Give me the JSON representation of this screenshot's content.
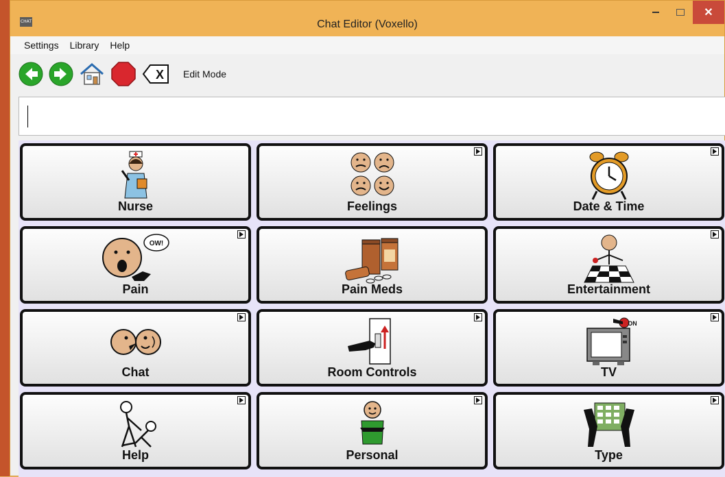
{
  "window": {
    "title": "Chat Editor (Voxello)",
    "app_icon_text": "CHAT",
    "close_glyph": "✕"
  },
  "menu": [
    "Settings",
    "Library",
    "Help"
  ],
  "toolbar": {
    "buttons": [
      {
        "icon": "back-arrow-icon",
        "color": "#2aa52a"
      },
      {
        "icon": "forward-arrow-icon",
        "color": "#2aa52a"
      },
      {
        "icon": "home-icon",
        "color": "#4a8bd0"
      },
      {
        "icon": "stop-icon",
        "color": "#d9272e"
      },
      {
        "icon": "clear-icon",
        "color": "#111111"
      }
    ],
    "clear_glyph": "X",
    "mode_label": "Edit Mode"
  },
  "message_bar": {
    "value": ""
  },
  "tiles": [
    {
      "label": "Nurse",
      "icon": "nurse-icon",
      "has_submenu": false
    },
    {
      "label": "Feelings",
      "icon": "feelings-faces-icon",
      "has_submenu": true
    },
    {
      "label": "Date & Time",
      "icon": "alarm-clock-icon",
      "has_submenu": true
    },
    {
      "label": "Pain",
      "icon": "pain-face-icon",
      "has_submenu": true,
      "bubble_text": "OW!"
    },
    {
      "label": "Pain Meds",
      "icon": "pill-bottles-icon",
      "has_submenu": false
    },
    {
      "label": "Entertainment",
      "icon": "checkers-player-icon",
      "has_submenu": true
    },
    {
      "label": "Chat",
      "icon": "two-faces-chat-icon",
      "has_submenu": true
    },
    {
      "label": "Room Controls",
      "icon": "light-switch-icon",
      "has_submenu": true
    },
    {
      "label": "TV",
      "icon": "television-icon",
      "has_submenu": true,
      "badge_text": "ON"
    },
    {
      "label": "Help",
      "icon": "helping-person-icon",
      "has_submenu": true
    },
    {
      "label": "Personal",
      "icon": "person-hug-icon",
      "has_submenu": true
    },
    {
      "label": "Type",
      "icon": "keyboard-hands-icon",
      "has_submenu": true
    }
  ]
}
